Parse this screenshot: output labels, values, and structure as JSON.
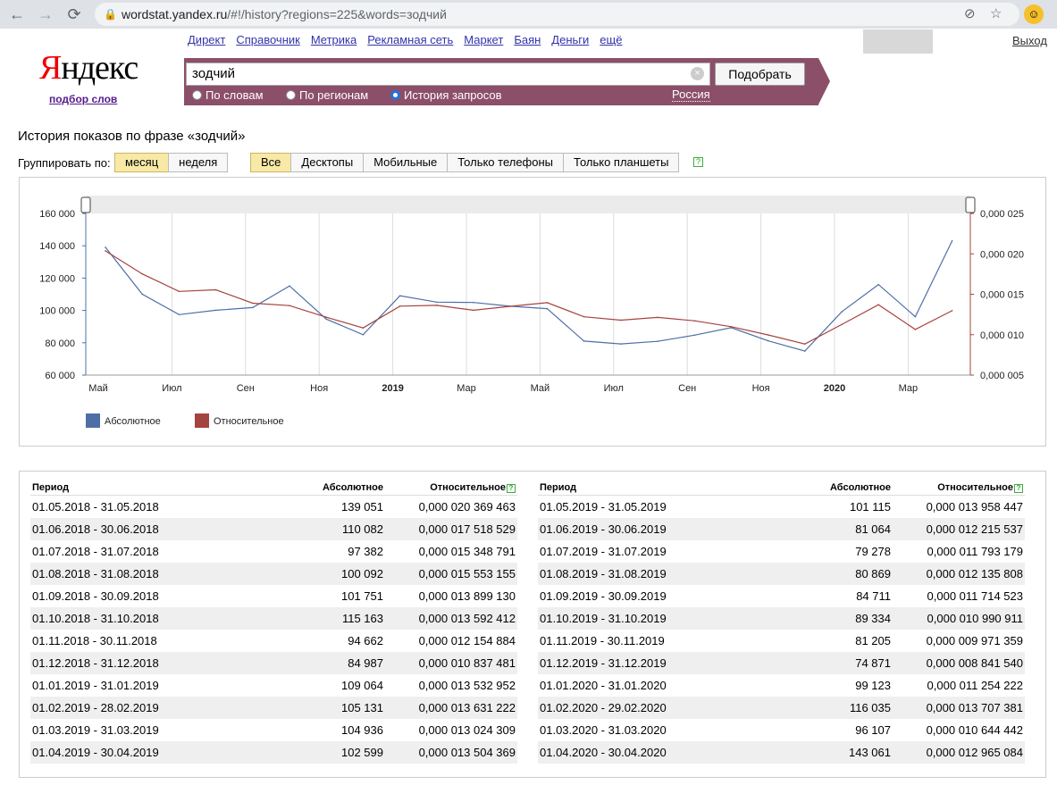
{
  "browser": {
    "url_host": "wordstat.yandex.ru",
    "url_path": "/#!/history?regions=225&words=зодчий"
  },
  "header": {
    "links": [
      "Директ",
      "Справочник",
      "Метрика",
      "Рекламная сеть",
      "Маркет",
      "Баян",
      "Деньги",
      "ещё"
    ],
    "logo": "Яндекс",
    "logo_sub": "подбор слов",
    "logout": "Выход"
  },
  "search": {
    "query": "зодчий",
    "button": "Подобрать",
    "modes": [
      "По словам",
      "По регионам",
      "История запросов"
    ],
    "selected_mode": "История запросов",
    "region": "Россия"
  },
  "main": {
    "title": "История показов по фразе «зодчий»",
    "group_label": "Группировать по:",
    "group_options": [
      "месяц",
      "неделя"
    ],
    "group_selected": "месяц",
    "device_options": [
      "Все",
      "Десктопы",
      "Мобильные",
      "Только телефоны",
      "Только планшеты"
    ],
    "device_selected": "Все",
    "help": "?"
  },
  "chart_data": {
    "type": "line",
    "x_tick_labels": [
      "Май",
      "Июл",
      "Сен",
      "Ноя",
      "2019",
      "Мар",
      "Май",
      "Июл",
      "Сен",
      "Ноя",
      "2020",
      "Мар"
    ],
    "y_left_ticks": [
      "160 000",
      "140 000",
      "120 000",
      "100 000",
      "80 000",
      "60 000"
    ],
    "y_right_ticks": [
      "0,000 025",
      "0,000 020",
      "0,000 015",
      "0,000 010",
      "0,000 005"
    ],
    "ylim_left": [
      60000,
      160000
    ],
    "ylim_right": [
      5e-06,
      2.5e-05
    ],
    "legend_position": "bottom-left",
    "series": [
      {
        "name": "Абсолютное",
        "color": "#4e6fa5",
        "axis": "left",
        "values": [
          139051,
          110082,
          97382,
          100092,
          101751,
          115163,
          94662,
          84987,
          109064,
          105131,
          104936,
          102599,
          101115,
          81064,
          79278,
          80869,
          84711,
          89334,
          81205,
          74871,
          99123,
          116035,
          96107,
          143061
        ]
      },
      {
        "name": "Относительное",
        "color": "#a5433f",
        "axis": "right",
        "values": [
          2.0369463e-05,
          1.7518529e-05,
          1.5348791e-05,
          1.5553155e-05,
          1.389913e-05,
          1.3592412e-05,
          1.2154884e-05,
          1.0837481e-05,
          1.3532952e-05,
          1.3631222e-05,
          1.3024309e-05,
          1.3504369e-05,
          1.3958447e-05,
          1.2215537e-05,
          1.1793179e-05,
          1.2135808e-05,
          1.1714523e-05,
          1.0990911e-05,
          9.971359e-06,
          8.84154e-06,
          1.1254222e-05,
          1.3707381e-05,
          1.0644442e-05,
          1.2965084e-05
        ]
      }
    ]
  },
  "table": {
    "headers": {
      "period": "Период",
      "absolute": "Абсолютное",
      "relative": "Относительное"
    },
    "left": [
      {
        "period": "01.05.2018 - 31.05.2018",
        "abs": "139 051",
        "rel": "0,000 020 369 463"
      },
      {
        "period": "01.06.2018 - 30.06.2018",
        "abs": "110 082",
        "rel": "0,000 017 518 529"
      },
      {
        "period": "01.07.2018 - 31.07.2018",
        "abs": "97 382",
        "rel": "0,000 015 348 791"
      },
      {
        "period": "01.08.2018 - 31.08.2018",
        "abs": "100 092",
        "rel": "0,000 015 553 155"
      },
      {
        "period": "01.09.2018 - 30.09.2018",
        "abs": "101 751",
        "rel": "0,000 013 899 130"
      },
      {
        "period": "01.10.2018 - 31.10.2018",
        "abs": "115 163",
        "rel": "0,000 013 592 412"
      },
      {
        "period": "01.11.2018 - 30.11.2018",
        "abs": "94 662",
        "rel": "0,000 012 154 884"
      },
      {
        "period": "01.12.2018 - 31.12.2018",
        "abs": "84 987",
        "rel": "0,000 010 837 481"
      },
      {
        "period": "01.01.2019 - 31.01.2019",
        "abs": "109 064",
        "rel": "0,000 013 532 952"
      },
      {
        "period": "01.02.2019 - 28.02.2019",
        "abs": "105 131",
        "rel": "0,000 013 631 222"
      },
      {
        "period": "01.03.2019 - 31.03.2019",
        "abs": "104 936",
        "rel": "0,000 013 024 309"
      },
      {
        "period": "01.04.2019 - 30.04.2019",
        "abs": "102 599",
        "rel": "0,000 013 504 369"
      }
    ],
    "right": [
      {
        "period": "01.05.2019 - 31.05.2019",
        "abs": "101 115",
        "rel": "0,000 013 958 447"
      },
      {
        "period": "01.06.2019 - 30.06.2019",
        "abs": "81 064",
        "rel": "0,000 012 215 537"
      },
      {
        "period": "01.07.2019 - 31.07.2019",
        "abs": "79 278",
        "rel": "0,000 011 793 179"
      },
      {
        "period": "01.08.2019 - 31.08.2019",
        "abs": "80 869",
        "rel": "0,000 012 135 808"
      },
      {
        "period": "01.09.2019 - 30.09.2019",
        "abs": "84 711",
        "rel": "0,000 011 714 523"
      },
      {
        "period": "01.10.2019 - 31.10.2019",
        "abs": "89 334",
        "rel": "0,000 010 990 911"
      },
      {
        "period": "01.11.2019 - 30.11.2019",
        "abs": "81 205",
        "rel": "0,000 009 971 359"
      },
      {
        "period": "01.12.2019 - 31.12.2019",
        "abs": "74 871",
        "rel": "0,000 008 841 540"
      },
      {
        "period": "01.01.2020 - 31.01.2020",
        "abs": "99 123",
        "rel": "0,000 011 254 222"
      },
      {
        "period": "01.02.2020 - 29.02.2020",
        "abs": "116 035",
        "rel": "0,000 013 707 381"
      },
      {
        "period": "01.03.2020 - 31.03.2020",
        "abs": "96 107",
        "rel": "0,000 010 644 442"
      },
      {
        "period": "01.04.2020 - 30.04.2020",
        "abs": "143 061",
        "rel": "0,000 012 965 084"
      }
    ]
  }
}
